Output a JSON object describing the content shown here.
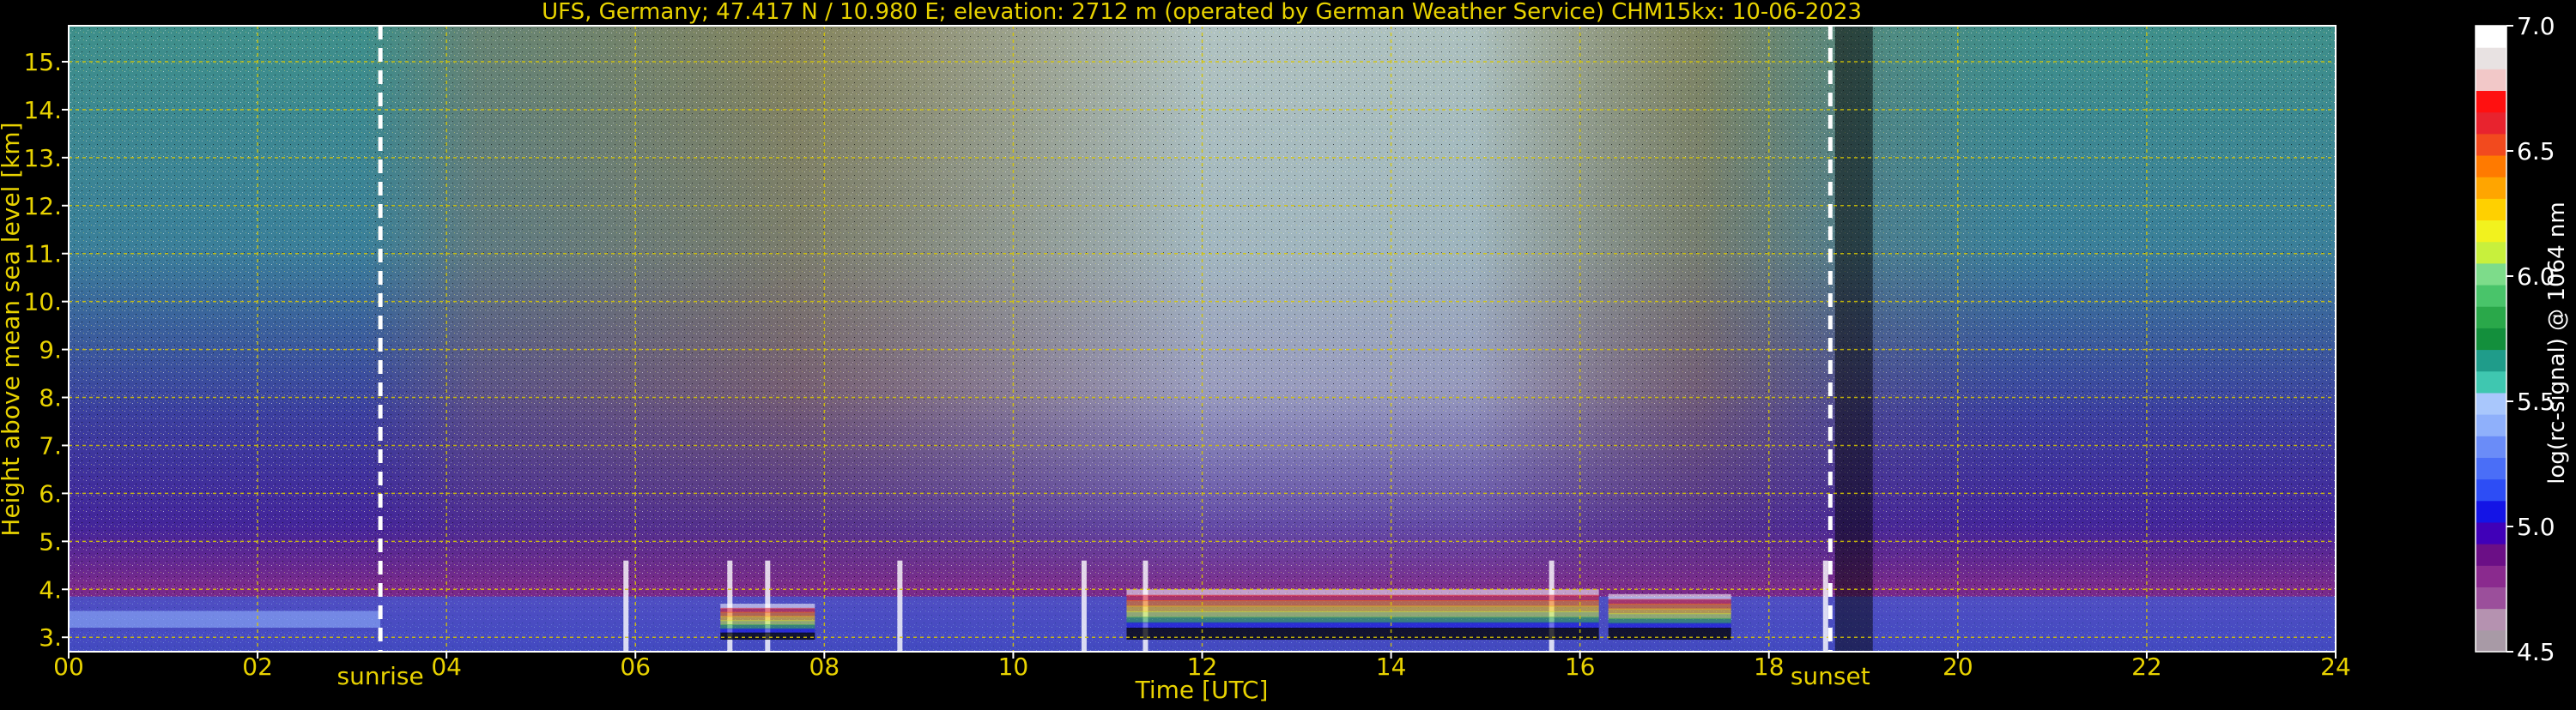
{
  "chart_data": {
    "type": "heatmap",
    "title": "UFS, Germany; 47.417 N / 10.980 E; elevation: 2712 m  (operated by German Weather Service)    CHM15kx: 10-06-2023",
    "xlabel": "Time [UTC]",
    "ylabel": "Height above mean sea level [km]",
    "xlim": [
      0,
      24
    ],
    "ylim": [
      2.7,
      15.75
    ],
    "x_ticks": [
      0,
      2,
      4,
      6,
      8,
      10,
      12,
      14,
      16,
      18,
      20,
      22,
      24
    ],
    "x_tick_labels": [
      "00",
      "02",
      "04",
      "06",
      "08",
      "10",
      "12",
      "14",
      "16",
      "18",
      "20",
      "22",
      "24"
    ],
    "y_ticks": [
      3,
      4,
      5,
      6,
      7,
      8,
      9,
      10,
      11,
      12,
      13,
      14,
      15
    ],
    "y_tick_labels": [
      "3.",
      "4.",
      "5.",
      "6.",
      "7.",
      "8.",
      "9.",
      "10.",
      "11.",
      "12.",
      "13.",
      "14.",
      "15."
    ],
    "grid": true,
    "annotations": [
      {
        "label": "sunrise",
        "x": 3.3
      },
      {
        "label": "sunset",
        "x": 18.65
      }
    ],
    "colorbar": {
      "label": "log(rc-signal) @ 1064 nm",
      "range": [
        4.5,
        7.0
      ],
      "ticks": [
        4.5,
        5.0,
        5.5,
        6.0,
        6.5,
        7.0
      ],
      "tick_labels": [
        "4.5",
        "5.0",
        "5.5",
        "6.0",
        "6.5",
        "7.0"
      ],
      "colors": [
        "#a89aa6",
        "#b592b0",
        "#9b4f9b",
        "#8a2a8e",
        "#6b0f86",
        "#4000b8",
        "#1414e6",
        "#2d4df5",
        "#4a6ef7",
        "#6a8cf8",
        "#8fb0fb",
        "#a9c7fc",
        "#3fc7b0",
        "#1f9c8a",
        "#138f3c",
        "#2aa84a",
        "#49c46a",
        "#7ddc8a",
        "#c8f03c",
        "#f2f21e",
        "#ffd000",
        "#ffa500",
        "#ff7a00",
        "#f24a1e",
        "#e8232e",
        "#ff1010",
        "#f2c8c8",
        "#e8e2e2",
        "#ffffff"
      ]
    },
    "heatmap_colors": {
      "upper_clear": "#3e8f8a",
      "mid": "#3b3f9f",
      "low": "#7b2a8b",
      "boundary_layer": "#2f6df0",
      "noise_day": "#b0704a",
      "noise_peak": "#d9d4d4"
    },
    "cloud_layers": [
      {
        "t0": 11.2,
        "t1": 16.2,
        "base": 3.2,
        "top": 4.0
      },
      {
        "t0": 16.3,
        "t1": 17.6,
        "base": 3.2,
        "top": 3.9
      },
      {
        "t0": 6.9,
        "t1": 7.9,
        "base": 3.1,
        "top": 3.7
      }
    ],
    "thin_streaks": [
      5.9,
      7.0,
      7.4,
      8.8,
      10.75,
      11.4,
      15.7,
      18.6
    ]
  },
  "colors": {
    "axis_text": "#e8d200",
    "tick_text": "#e8d200",
    "grid": "#d9c800",
    "frame": "#ffffff",
    "annotation_line": "#ffffff",
    "colorbar_text": "#ffffff"
  }
}
